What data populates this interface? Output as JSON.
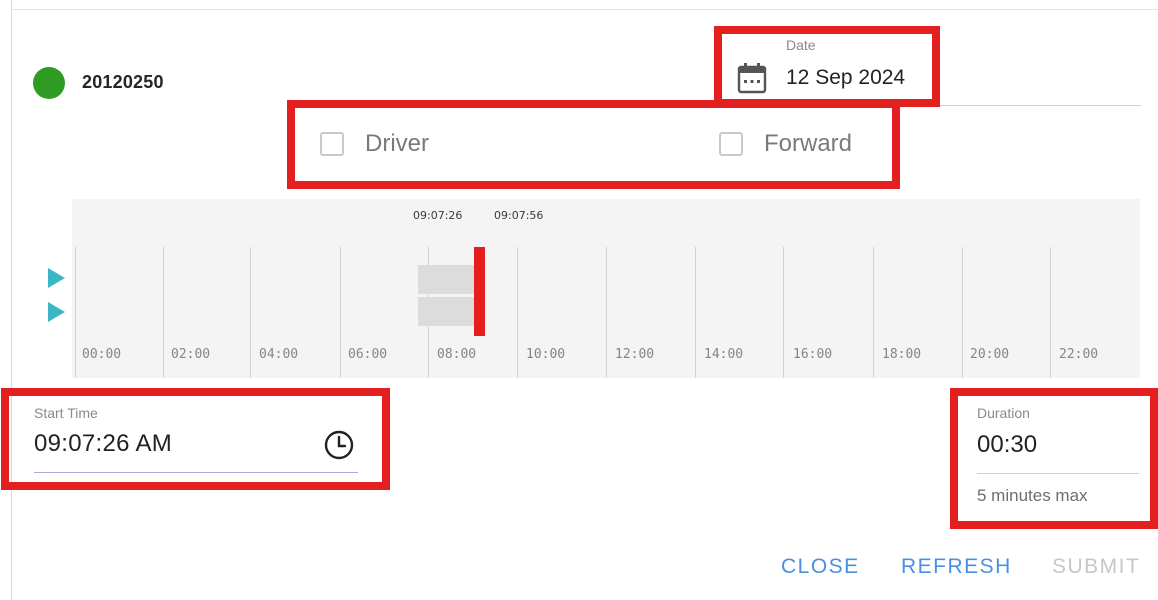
{
  "vehicle": {
    "id": "20120250",
    "status_color": "#2e9c22"
  },
  "date_field": {
    "label": "Date",
    "value": "12 Sep 2024",
    "icon": "calendar-icon"
  },
  "options": {
    "driver_label": "Driver",
    "driver_checked": false,
    "forward_label": "Forward",
    "forward_checked": false
  },
  "timeline": {
    "selection_start": "09:07:26",
    "selection_end": "09:07:56",
    "hours": [
      "00:00",
      "02:00",
      "04:00",
      "06:00",
      "08:00",
      "10:00",
      "12:00",
      "14:00",
      "16:00",
      "18:00",
      "20:00",
      "22:00"
    ],
    "cursor_color": "#e31f1f",
    "channel_icon": "play-arrow-icon"
  },
  "start_time": {
    "label": "Start Time",
    "value": "09:07:26 AM",
    "icon": "clock-icon"
  },
  "duration": {
    "label": "Duration",
    "value": "00:30",
    "hint": "5 minutes max"
  },
  "actions": {
    "close": "CLOSE",
    "refresh": "REFRESH",
    "submit": "SUBMIT",
    "accent_color": "#4a90e2"
  },
  "highlight_color": "#e31f1f"
}
